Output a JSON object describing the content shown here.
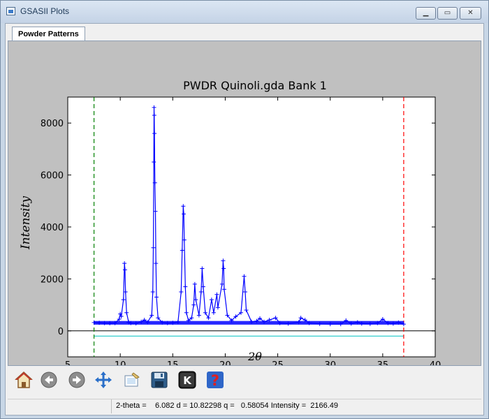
{
  "window": {
    "title": "GSASII Plots",
    "icon": "app-window-icon"
  },
  "tabs": [
    {
      "label": "Powder Patterns",
      "active": true
    }
  ],
  "chart_data": {
    "type": "scatter",
    "title": "PWDR Quinoli.gda Bank 1",
    "xlabel": "2θ",
    "ylabel": "Intensity",
    "xlim": [
      5,
      40
    ],
    "ylim": [
      -1000,
      9000
    ],
    "x_ticks": [
      "5",
      "10",
      "15",
      "20",
      "25",
      "30",
      "35",
      "40"
    ],
    "y_ticks": [
      "0",
      "2000",
      "4000",
      "6000",
      "8000"
    ],
    "series": [
      {
        "style": "blue-plus-markers",
        "color": "#0000ff",
        "points": [
          [
            7.5,
            320
          ],
          [
            8.0,
            310
          ],
          [
            8.5,
            300
          ],
          [
            9.0,
            295
          ],
          [
            9.5,
            300
          ],
          [
            9.9,
            450
          ],
          [
            10.0,
            650
          ],
          [
            10.1,
            560
          ],
          [
            10.3,
            1200
          ],
          [
            10.4,
            2600
          ],
          [
            10.45,
            2350
          ],
          [
            10.5,
            1500
          ],
          [
            10.6,
            700
          ],
          [
            10.8,
            330
          ],
          [
            11.0,
            300
          ],
          [
            11.5,
            290
          ],
          [
            12.0,
            350
          ],
          [
            12.3,
            420
          ],
          [
            12.6,
            330
          ],
          [
            13.0,
            600
          ],
          [
            13.1,
            1500
          ],
          [
            13.15,
            3200
          ],
          [
            13.2,
            6500
          ],
          [
            13.22,
            8600
          ],
          [
            13.24,
            8300
          ],
          [
            13.26,
            7600
          ],
          [
            13.3,
            5700
          ],
          [
            13.35,
            4600
          ],
          [
            13.4,
            2600
          ],
          [
            13.45,
            1300
          ],
          [
            13.6,
            500
          ],
          [
            14.0,
            320
          ],
          [
            14.5,
            300
          ],
          [
            15.0,
            310
          ],
          [
            15.5,
            340
          ],
          [
            15.8,
            1500
          ],
          [
            15.9,
            3100
          ],
          [
            16.0,
            4800
          ],
          [
            16.05,
            4500
          ],
          [
            16.1,
            3500
          ],
          [
            16.2,
            1700
          ],
          [
            16.3,
            700
          ],
          [
            16.5,
            400
          ],
          [
            16.8,
            500
          ],
          [
            17.0,
            1000
          ],
          [
            17.1,
            1800
          ],
          [
            17.2,
            1200
          ],
          [
            17.5,
            600
          ],
          [
            17.7,
            1500
          ],
          [
            17.8,
            2400
          ],
          [
            17.9,
            1700
          ],
          [
            18.1,
            700
          ],
          [
            18.4,
            500
          ],
          [
            18.7,
            1200
          ],
          [
            18.9,
            700
          ],
          [
            19.2,
            1400
          ],
          [
            19.3,
            900
          ],
          [
            19.7,
            1800
          ],
          [
            19.8,
            2700
          ],
          [
            19.85,
            2400
          ],
          [
            19.9,
            1600
          ],
          [
            20.2,
            600
          ],
          [
            20.6,
            400
          ],
          [
            21.0,
            550
          ],
          [
            21.5,
            700
          ],
          [
            21.8,
            2100
          ],
          [
            21.9,
            1500
          ],
          [
            22.0,
            800
          ],
          [
            22.5,
            350
          ],
          [
            23.0,
            380
          ],
          [
            23.3,
            480
          ],
          [
            23.7,
            350
          ],
          [
            24.2,
            420
          ],
          [
            24.8,
            500
          ],
          [
            25.2,
            300
          ],
          [
            26.0,
            280
          ],
          [
            27.0,
            330
          ],
          [
            27.2,
            500
          ],
          [
            27.6,
            420
          ],
          [
            28.0,
            300
          ],
          [
            29.0,
            270
          ],
          [
            30.0,
            260
          ],
          [
            31.0,
            260
          ],
          [
            31.5,
            400
          ],
          [
            32.0,
            280
          ],
          [
            32.6,
            330
          ],
          [
            33.0,
            280
          ],
          [
            33.8,
            270
          ],
          [
            34.5,
            300
          ],
          [
            35.0,
            450
          ],
          [
            35.5,
            300
          ],
          [
            36.0,
            280
          ],
          [
            36.5,
            320
          ],
          [
            37.0,
            260
          ]
        ]
      }
    ],
    "vertical_lines": [
      {
        "x": 7.5,
        "style": "dashed",
        "color": "#008000"
      },
      {
        "x": 37.0,
        "style": "dashed",
        "color": "#ff0000"
      }
    ],
    "horizontal_lines": [
      {
        "y": 0,
        "color": "#000000"
      },
      {
        "y": -200,
        "color": "#00c0c0",
        "xrange": [
          7.5,
          37.0
        ]
      }
    ],
    "grid": false
  },
  "toolbar": {
    "buttons": [
      {
        "icon": "home-icon"
      },
      {
        "icon": "back-arrow-icon"
      },
      {
        "icon": "forward-arrow-icon"
      },
      {
        "icon": "pan-icon"
      },
      {
        "icon": "configure-subplots-icon"
      },
      {
        "icon": "save-disk-icon"
      },
      {
        "icon": "k-key-icon"
      },
      {
        "icon": "help-icon"
      }
    ]
  },
  "status": {
    "text": "2-theta =    6.082 d = 10.82298 q =   0.58054 Intensity =  2166.49"
  }
}
